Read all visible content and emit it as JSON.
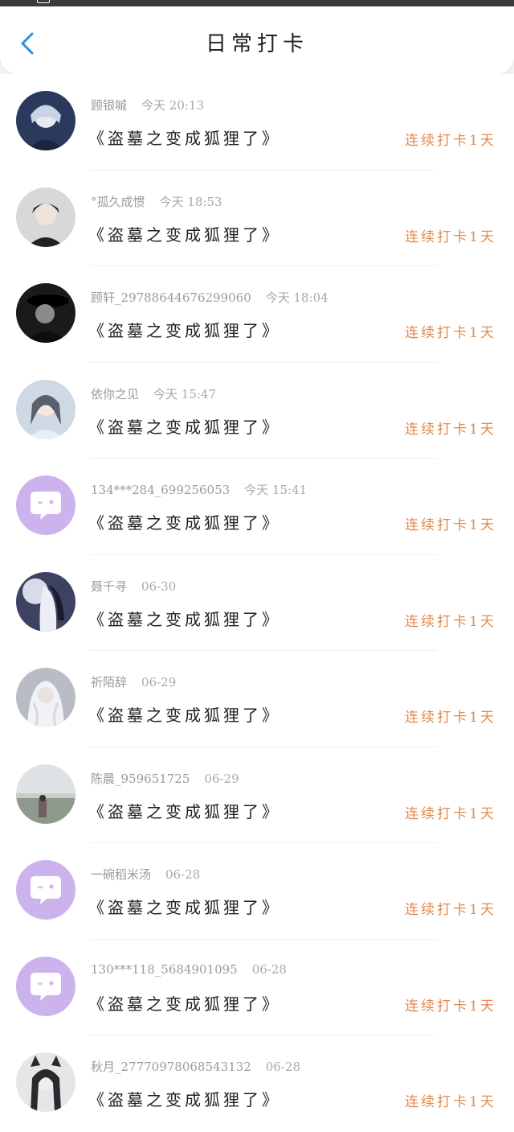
{
  "header": {
    "title": "日常打卡"
  },
  "checkins": [
    {
      "user": "顾银嘁",
      "time": "今天 20:13",
      "book": "《盗墓之变成狐狸了》",
      "streak": "连续打卡1天",
      "avatar": "dark-blue-anime-avatar"
    },
    {
      "user": "°孤久成惯",
      "time": "今天 18:53",
      "book": "《盗墓之变成狐狸了》",
      "streak": "连续打卡1天",
      "avatar": "dark-hair-anime-avatar"
    },
    {
      "user": "顾轩_29788644676299060",
      "time": "今天 18:04",
      "book": "《盗墓之变成狐狸了》",
      "streak": "连续打卡1天",
      "avatar": "black-hat-avatar"
    },
    {
      "user": "依你之见",
      "time": "今天 15:47",
      "book": "《盗墓之变成狐狸了》",
      "streak": "连续打卡1天",
      "avatar": "blindfold-anime-avatar"
    },
    {
      "user": "134***284_699256053",
      "time": "今天 15:41",
      "book": "《盗墓之变成狐狸了》",
      "streak": "连续打卡1天",
      "avatar": "default-chat-avatar"
    },
    {
      "user": "聂千寻",
      "time": "06-30",
      "book": "《盗墓之变成狐狸了》",
      "streak": "连续打卡1天",
      "avatar": "moon-anime-avatar"
    },
    {
      "user": "祈陌辞",
      "time": "06-29",
      "book": "《盗墓之变成狐狸了》",
      "streak": "连续打卡1天",
      "avatar": "white-hair-anime-avatar"
    },
    {
      "user": "陈晨_959651725",
      "time": "06-29",
      "book": "《盗墓之变成狐狸了》",
      "streak": "连续打卡1天",
      "avatar": "outdoor-photo-avatar"
    },
    {
      "user": "一碗稻米汤",
      "time": "06-28",
      "book": "《盗墓之变成狐狸了》",
      "streak": "连续打卡1天",
      "avatar": "default-chat-avatar"
    },
    {
      "user": "130***118_5684901095",
      "time": "06-28",
      "book": "《盗墓之变成狐狸了》",
      "streak": "连续打卡1天",
      "avatar": "default-chat-avatar"
    },
    {
      "user": "秋月_27770978068543132",
      "time": "06-28",
      "book": "《盗墓之变成狐狸了》",
      "streak": "连续打卡1天",
      "avatar": "animal-ear-anime-avatar"
    }
  ],
  "colors": {
    "accent": "#e28a4c",
    "back_arrow": "#2d8ee6",
    "default_avatar_bg": "#cdb3ee"
  }
}
